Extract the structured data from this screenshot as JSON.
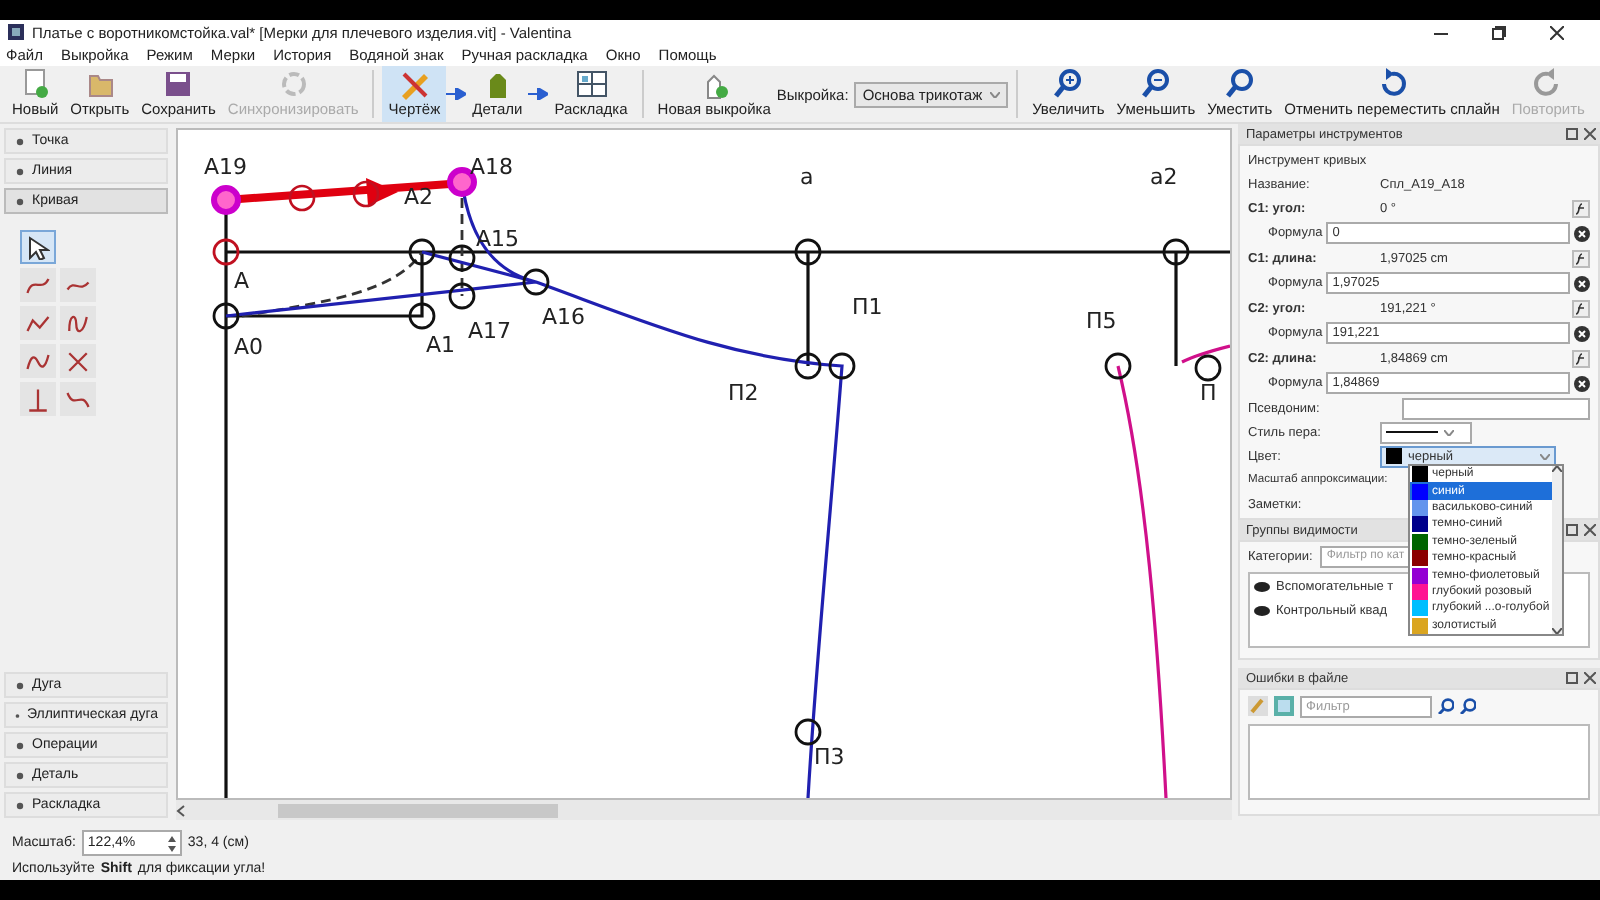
{
  "window": {
    "title": "Платье с воротникомстойка.val* [Мерки для плечевого изделия.vit] - Valentina"
  },
  "menu": [
    "Файл",
    "Выкройка",
    "Режим",
    "Мерки",
    "История",
    "Водяной знак",
    "Ручная раскладка",
    "Окно",
    "Помощь"
  ],
  "toolbar": {
    "file_buttons": [
      {
        "label": "Новый",
        "disabled": false
      },
      {
        "label": "Открыть",
        "disabled": false
      },
      {
        "label": "Сохранить",
        "disabled": false
      },
      {
        "label": "Синхронизировать",
        "disabled": true
      }
    ],
    "mode_buttons": [
      {
        "label": "Чертёж",
        "selected": true
      },
      {
        "label": "Детали",
        "selected": false
      },
      {
        "label": "Раскладка",
        "selected": false
      }
    ],
    "new_pattern": "Новая выкройка",
    "pattern_label": "Выкройка:",
    "pattern_value": "Основа трикотаж",
    "view_buttons": [
      {
        "label": "Увеличить",
        "disabled": false
      },
      {
        "label": "Уменьшить",
        "disabled": false
      },
      {
        "label": "Уместить",
        "disabled": false
      },
      {
        "label": "Отменить переместить сплайн",
        "disabled": false
      },
      {
        "label": "Повторить",
        "disabled": true
      }
    ]
  },
  "tool_panel": {
    "top_groups": [
      {
        "label": "Точка",
        "selected": false
      },
      {
        "label": "Линия",
        "selected": false
      },
      {
        "label": "Кривая",
        "selected": true
      }
    ],
    "tools": [
      {
        "kind": "pointer",
        "selected": true
      },
      {
        "kind": "curve",
        "selected": false
      },
      {
        "kind": "curve",
        "selected": false
      },
      {
        "kind": "curve",
        "selected": false
      },
      {
        "kind": "curve",
        "selected": false
      },
      {
        "kind": "curve",
        "selected": false
      },
      {
        "kind": "curve",
        "selected": false
      },
      {
        "kind": "curve",
        "selected": false
      },
      {
        "kind": "curve",
        "selected": false
      }
    ],
    "bottom_groups": [
      {
        "label": "Дуга",
        "selected": false
      },
      {
        "label": "Эллиптическая дуга",
        "selected": false
      },
      {
        "label": "Операции",
        "selected": false
      },
      {
        "label": "Деталь",
        "selected": false
      },
      {
        "label": "Раскладка",
        "selected": false
      }
    ]
  },
  "canvas": {
    "points": [
      {
        "label": "A19",
        "selected": true
      },
      {
        "label": "A18",
        "selected": true
      },
      {
        "label": "A2",
        "selected": false
      },
      {
        "label": "A",
        "selected": false
      },
      {
        "label": "A15",
        "selected": false
      },
      {
        "label": "A16",
        "selected": false
      },
      {
        "label": "A17",
        "selected": false
      },
      {
        "label": "A0",
        "selected": false
      },
      {
        "label": "A1",
        "selected": false
      },
      {
        "label": "а",
        "selected": false
      },
      {
        "label": "а2",
        "selected": false
      },
      {
        "label": "П1",
        "selected": false
      },
      {
        "label": "П2",
        "selected": false
      },
      {
        "label": "П5",
        "selected": false
      },
      {
        "label": "П",
        "selected": false
      },
      {
        "label": "П3",
        "selected": false
      }
    ]
  },
  "scale": {
    "label": "Масштаб:",
    "value": "122,4%",
    "position": "33, 4 (см)"
  },
  "tool_options": {
    "title": "Параметры инструментов",
    "group": "Инструмент кривых",
    "name_label": "Название:",
    "name_value": "Спл_A19_A18",
    "params": [
      {
        "label": "C1: угол:",
        "value": "0 °",
        "formula_label": "Формула",
        "formula": "0"
      },
      {
        "label": "C1: длина:",
        "value": "1,97025 cm",
        "formula_label": "Формула",
        "formula": "1,97025"
      },
      {
        "label": "C2: угол:",
        "value": "191,221 °",
        "formula_label": "Формула",
        "formula": "191,221"
      },
      {
        "label": "C2: длина:",
        "value": "1,84869 cm",
        "formula_label": "Формула",
        "formula": "1,84869"
      }
    ],
    "alias_label": "Псевдоним:",
    "pen_label": "Стиль пера:",
    "color_label": "Цвет:",
    "color_value": {
      "label": "черный",
      "color": "#000000"
    },
    "approx_label": "Масштаб аппроксимации:",
    "notes_label": "Заметки:",
    "color_options": [
      {
        "label": "черный",
        "color": "#000000",
        "selected": false
      },
      {
        "label": "синий",
        "color": "#0000ff",
        "selected": true
      },
      {
        "label": "васильково-синий",
        "color": "#6495ed",
        "selected": false
      },
      {
        "label": "темно-синий",
        "color": "#00008b",
        "selected": false
      },
      {
        "label": "темно-зеленый",
        "color": "#006400",
        "selected": false
      },
      {
        "label": "темно-красный",
        "color": "#8b0000",
        "selected": false
      },
      {
        "label": "темно-фиолетовый",
        "color": "#9400d3",
        "selected": false
      },
      {
        "label": "глубокий розовый",
        "color": "#ff1493",
        "selected": false
      },
      {
        "label": "глубокий ...о-голубой",
        "color": "#00bfff",
        "selected": false
      },
      {
        "label": "золотистый",
        "color": "#daa520",
        "selected": false
      }
    ]
  },
  "visibility_groups": {
    "title": "Группы видимости",
    "category_label": "Категории:",
    "filter_placeholder": "Фильтр по кат",
    "rows": [
      "Вспомогательные т",
      "Контрольный квад"
    ]
  },
  "file_errors": {
    "title": "Ошибки в файле",
    "filter_placeholder": "Фильтр"
  },
  "status_bar": {
    "message": "Используйте **Shift** для фиксации угла!"
  }
}
